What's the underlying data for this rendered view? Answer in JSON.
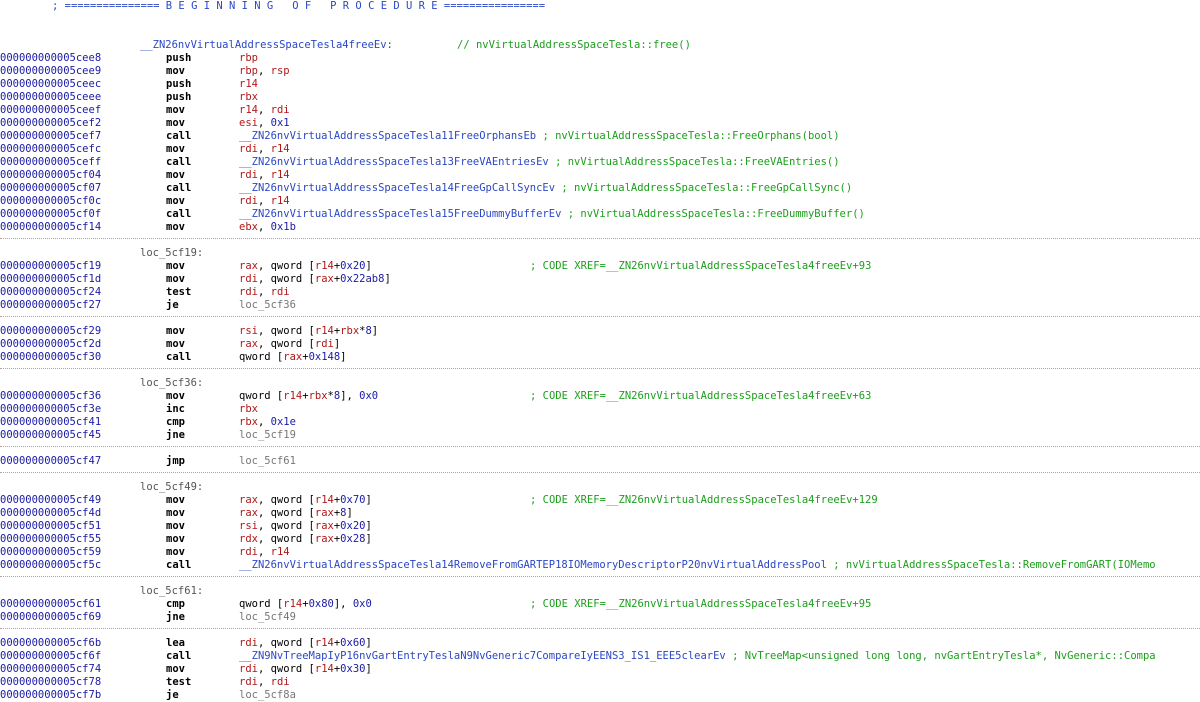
{
  "banner": "; =============== B E G I N N I N G   O F   P R O C E D U R E ================",
  "func_label": "__ZN26nvVirtualAddressSpaceTesla4freeEv:",
  "func_comment": "// nvVirtualAddressSpaceTesla::free()",
  "labels": {
    "l1": "loc_5cf19:",
    "l2": "loc_5cf36:",
    "l3": "loc_5cf49:",
    "l4": "loc_5cf61:"
  },
  "rows": [
    {
      "addr": "000000000005cee8",
      "mn": "push",
      "op": [
        [
          "reg",
          "rbp"
        ]
      ]
    },
    {
      "addr": "000000000005cee9",
      "mn": "mov",
      "op": [
        [
          "reg",
          "rbp"
        ],
        [
          "txt",
          ", "
        ],
        [
          "reg",
          "rsp"
        ]
      ]
    },
    {
      "addr": "000000000005ceec",
      "mn": "push",
      "op": [
        [
          "reg",
          "r14"
        ]
      ]
    },
    {
      "addr": "000000000005ceee",
      "mn": "push",
      "op": [
        [
          "reg",
          "rbx"
        ]
      ]
    },
    {
      "addr": "000000000005ceef",
      "mn": "mov",
      "op": [
        [
          "reg",
          "r14"
        ],
        [
          "txt",
          ", "
        ],
        [
          "reg",
          "rdi"
        ]
      ]
    },
    {
      "addr": "000000000005cef2",
      "mn": "mov",
      "op": [
        [
          "reg",
          "esi"
        ],
        [
          "txt",
          ", "
        ],
        [
          "num",
          "0x1"
        ]
      ]
    },
    {
      "addr": "000000000005cef7",
      "mn": "call",
      "op": [
        [
          "sym",
          "__ZN26nvVirtualAddressSpaceTesla11FreeOrphansEb"
        ],
        [
          "cm",
          " ; nvVirtualAddressSpaceTesla::FreeOrphans(bool)"
        ]
      ]
    },
    {
      "addr": "000000000005cefc",
      "mn": "mov",
      "op": [
        [
          "reg",
          "rdi"
        ],
        [
          "txt",
          ", "
        ],
        [
          "reg",
          "r14"
        ]
      ]
    },
    {
      "addr": "000000000005ceff",
      "mn": "call",
      "op": [
        [
          "sym",
          "__ZN26nvVirtualAddressSpaceTesla13FreeVAEntriesEv"
        ],
        [
          "cm",
          " ; nvVirtualAddressSpaceTesla::FreeVAEntries()"
        ]
      ]
    },
    {
      "addr": "000000000005cf04",
      "mn": "mov",
      "op": [
        [
          "reg",
          "rdi"
        ],
        [
          "txt",
          ", "
        ],
        [
          "reg",
          "r14"
        ]
      ]
    },
    {
      "addr": "000000000005cf07",
      "mn": "call",
      "op": [
        [
          "sym",
          "__ZN26nvVirtualAddressSpaceTesla14FreeGpCallSyncEv"
        ],
        [
          "cm",
          " ; nvVirtualAddressSpaceTesla::FreeGpCallSync()"
        ]
      ]
    },
    {
      "addr": "000000000005cf0c",
      "mn": "mov",
      "op": [
        [
          "reg",
          "rdi"
        ],
        [
          "txt",
          ", "
        ],
        [
          "reg",
          "r14"
        ]
      ]
    },
    {
      "addr": "000000000005cf0f",
      "mn": "call",
      "op": [
        [
          "sym",
          "__ZN26nvVirtualAddressSpaceTesla15FreeDummyBufferEv"
        ],
        [
          "cm",
          " ; nvVirtualAddressSpaceTesla::FreeDummyBuffer()"
        ]
      ]
    },
    {
      "addr": "000000000005cf14",
      "mn": "mov",
      "op": [
        [
          "reg",
          "ebx"
        ],
        [
          "txt",
          ", "
        ],
        [
          "num",
          "0x1b"
        ]
      ]
    },
    {
      "addr": "000000000005cf19",
      "mn": "mov",
      "op": [
        [
          "reg",
          "rax"
        ],
        [
          "txt",
          ", qword ["
        ],
        [
          "reg",
          "r14"
        ],
        [
          "txt",
          "+"
        ],
        [
          "num",
          "0x20"
        ],
        [
          "txt",
          "]"
        ]
      ],
      "xref": "; CODE XREF=__ZN26nvVirtualAddressSpaceTesla4freeEv+93"
    },
    {
      "addr": "000000000005cf1d",
      "mn": "mov",
      "op": [
        [
          "reg",
          "rdi"
        ],
        [
          "txt",
          ", qword ["
        ],
        [
          "reg",
          "rax"
        ],
        [
          "txt",
          "+"
        ],
        [
          "num",
          "0x22ab8"
        ],
        [
          "txt",
          "]"
        ]
      ]
    },
    {
      "addr": "000000000005cf24",
      "mn": "test",
      "op": [
        [
          "reg",
          "rdi"
        ],
        [
          "txt",
          ", "
        ],
        [
          "reg",
          "rdi"
        ]
      ]
    },
    {
      "addr": "000000000005cf27",
      "mn": "je",
      "op": [
        [
          "loc",
          "loc_5cf36"
        ]
      ]
    },
    {
      "addr": "000000000005cf29",
      "mn": "mov",
      "op": [
        [
          "reg",
          "rsi"
        ],
        [
          "txt",
          ", qword ["
        ],
        [
          "reg",
          "r14"
        ],
        [
          "txt",
          "+"
        ],
        [
          "reg",
          "rbx"
        ],
        [
          "txt",
          "*"
        ],
        [
          "num",
          "8"
        ],
        [
          "txt",
          "]"
        ]
      ]
    },
    {
      "addr": "000000000005cf2d",
      "mn": "mov",
      "op": [
        [
          "reg",
          "rax"
        ],
        [
          "txt",
          ", qword ["
        ],
        [
          "reg",
          "rdi"
        ],
        [
          "txt",
          "]"
        ]
      ]
    },
    {
      "addr": "000000000005cf30",
      "mn": "call",
      "op": [
        [
          "txt",
          "qword ["
        ],
        [
          "reg",
          "rax"
        ],
        [
          "txt",
          "+"
        ],
        [
          "num",
          "0x148"
        ],
        [
          "txt",
          "]"
        ]
      ]
    },
    {
      "addr": "000000000005cf36",
      "mn": "mov",
      "op": [
        [
          "txt",
          "qword ["
        ],
        [
          "reg",
          "r14"
        ],
        [
          "txt",
          "+"
        ],
        [
          "reg",
          "rbx"
        ],
        [
          "txt",
          "*"
        ],
        [
          "num",
          "8"
        ],
        [
          "txt",
          "], "
        ],
        [
          "num",
          "0x0"
        ]
      ],
      "xref": "; CODE XREF=__ZN26nvVirtualAddressSpaceTesla4freeEv+63"
    },
    {
      "addr": "000000000005cf3e",
      "mn": "inc",
      "op": [
        [
          "reg",
          "rbx"
        ]
      ]
    },
    {
      "addr": "000000000005cf41",
      "mn": "cmp",
      "op": [
        [
          "reg",
          "rbx"
        ],
        [
          "txt",
          ", "
        ],
        [
          "num",
          "0x1e"
        ]
      ]
    },
    {
      "addr": "000000000005cf45",
      "mn": "jne",
      "op": [
        [
          "loc",
          "loc_5cf19"
        ]
      ]
    },
    {
      "addr": "000000000005cf47",
      "mn": "jmp",
      "op": [
        [
          "loc",
          "loc_5cf61"
        ]
      ]
    },
    {
      "addr": "000000000005cf49",
      "mn": "mov",
      "op": [
        [
          "reg",
          "rax"
        ],
        [
          "txt",
          ", qword ["
        ],
        [
          "reg",
          "r14"
        ],
        [
          "txt",
          "+"
        ],
        [
          "num",
          "0x70"
        ],
        [
          "txt",
          "]"
        ]
      ],
      "xref": "; CODE XREF=__ZN26nvVirtualAddressSpaceTesla4freeEv+129"
    },
    {
      "addr": "000000000005cf4d",
      "mn": "mov",
      "op": [
        [
          "reg",
          "rax"
        ],
        [
          "txt",
          ", qword ["
        ],
        [
          "reg",
          "rax"
        ],
        [
          "txt",
          "+"
        ],
        [
          "num",
          "8"
        ],
        [
          "txt",
          "]"
        ]
      ]
    },
    {
      "addr": "000000000005cf51",
      "mn": "mov",
      "op": [
        [
          "reg",
          "rsi"
        ],
        [
          "txt",
          ", qword ["
        ],
        [
          "reg",
          "rax"
        ],
        [
          "txt",
          "+"
        ],
        [
          "num",
          "0x20"
        ],
        [
          "txt",
          "]"
        ]
      ]
    },
    {
      "addr": "000000000005cf55",
      "mn": "mov",
      "op": [
        [
          "reg",
          "rdx"
        ],
        [
          "txt",
          ", qword ["
        ],
        [
          "reg",
          "rax"
        ],
        [
          "txt",
          "+"
        ],
        [
          "num",
          "0x28"
        ],
        [
          "txt",
          "]"
        ]
      ]
    },
    {
      "addr": "000000000005cf59",
      "mn": "mov",
      "op": [
        [
          "reg",
          "rdi"
        ],
        [
          "txt",
          ", "
        ],
        [
          "reg",
          "r14"
        ]
      ]
    },
    {
      "addr": "000000000005cf5c",
      "mn": "call",
      "op": [
        [
          "sym",
          "__ZN26nvVirtualAddressSpaceTesla14RemoveFromGARTEP18IOMemoryDescriptorP20nvVirtualAddressPool"
        ],
        [
          "cm",
          " ; nvVirtualAddressSpaceTesla::RemoveFromGART(IOMemo"
        ]
      ]
    },
    {
      "addr": "000000000005cf61",
      "mn": "cmp",
      "op": [
        [
          "txt",
          "qword ["
        ],
        [
          "reg",
          "r14"
        ],
        [
          "txt",
          "+"
        ],
        [
          "num",
          "0x80"
        ],
        [
          "txt",
          "], "
        ],
        [
          "num",
          "0x0"
        ]
      ],
      "xref": "; CODE XREF=__ZN26nvVirtualAddressSpaceTesla4freeEv+95"
    },
    {
      "addr": "000000000005cf69",
      "mn": "jne",
      "op": [
        [
          "loc",
          "loc_5cf49"
        ]
      ]
    },
    {
      "addr": "000000000005cf6b",
      "mn": "lea",
      "op": [
        [
          "reg",
          "rdi"
        ],
        [
          "txt",
          ", qword ["
        ],
        [
          "reg",
          "r14"
        ],
        [
          "txt",
          "+"
        ],
        [
          "num",
          "0x60"
        ],
        [
          "txt",
          "]"
        ]
      ]
    },
    {
      "addr": "000000000005cf6f",
      "mn": "call",
      "op": [
        [
          "sym",
          "__ZN9NvTreeMapIyP16nvGartEntryTeslaN9NvGeneric7CompareIyEENS3_IS1_EEE5clearEv"
        ],
        [
          "cm",
          " ; NvTreeMap<unsigned long long, nvGartEntryTesla*, NvGeneric::Compa"
        ]
      ]
    },
    {
      "addr": "000000000005cf74",
      "mn": "mov",
      "op": [
        [
          "reg",
          "rdi"
        ],
        [
          "txt",
          ", qword ["
        ],
        [
          "reg",
          "r14"
        ],
        [
          "txt",
          "+"
        ],
        [
          "num",
          "0x30"
        ],
        [
          "txt",
          "]"
        ]
      ]
    },
    {
      "addr": "000000000005cf78",
      "mn": "test",
      "op": [
        [
          "reg",
          "rdi"
        ],
        [
          "txt",
          ", "
        ],
        [
          "reg",
          "rdi"
        ]
      ]
    },
    {
      "addr": "000000000005cf7b",
      "mn": "je",
      "op": [
        [
          "loc",
          "loc_5cf8a"
        ]
      ]
    }
  ]
}
